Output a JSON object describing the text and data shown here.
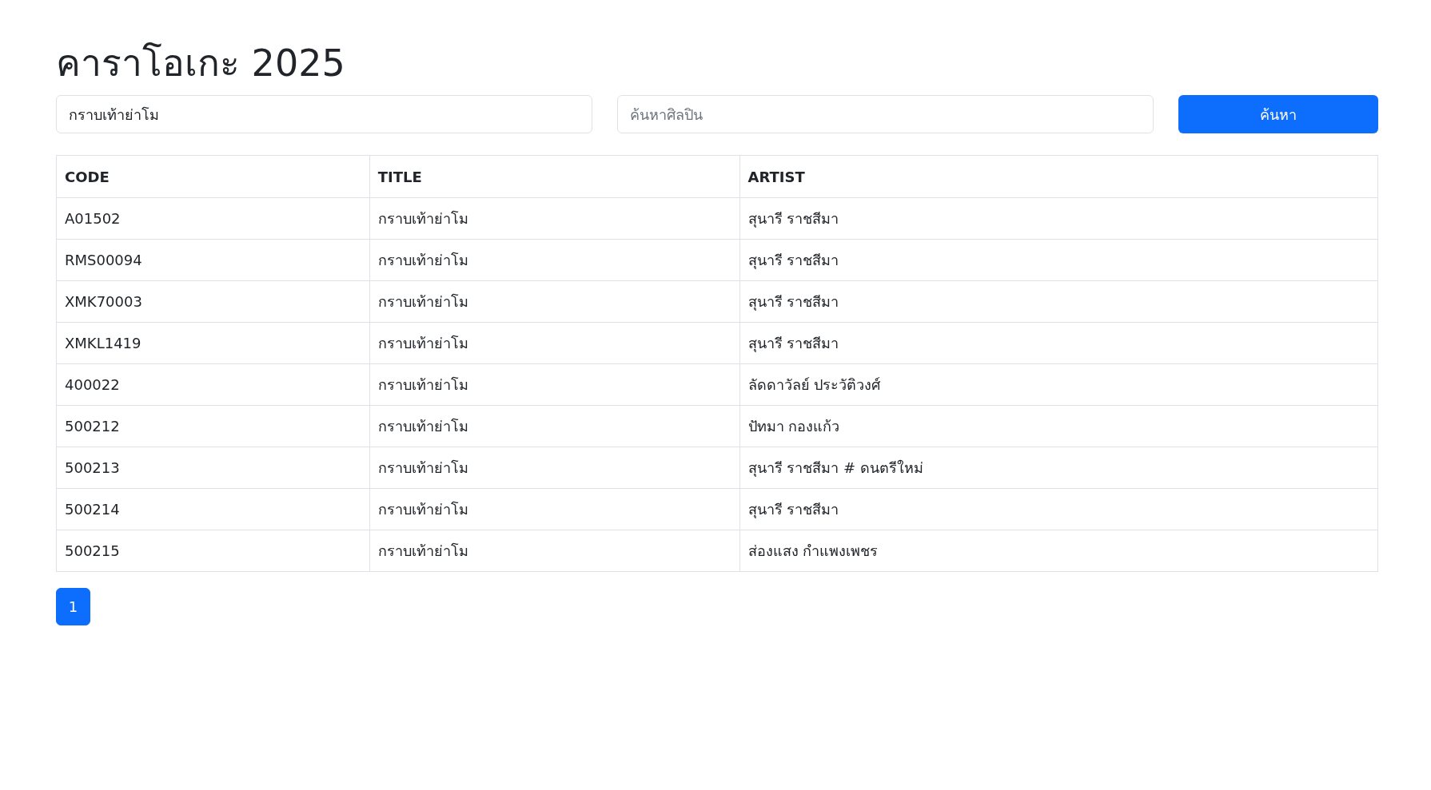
{
  "title": "คาราโอเกะ 2025",
  "search": {
    "title_value": "กราบเท้าย่าโม",
    "artist_placeholder": "ค้นหาศิลปิน",
    "button": "ค้นหา"
  },
  "table": {
    "columns": [
      "CODE",
      "TITLE",
      "ARTIST"
    ],
    "rows": [
      [
        "A01502",
        "กราบเท้าย่าโม",
        "สุนารี ราชสีมา"
      ],
      [
        "RMS00094",
        "กราบเท้าย่าโม",
        "สุนารี ราชสีมา"
      ],
      [
        "XMK70003",
        "กราบเท้าย่าโม",
        "สุนารี ราชสีมา"
      ],
      [
        "XMKL1419",
        "กราบเท้าย่าโม",
        "สุนารี ราชสีมา"
      ],
      [
        "400022",
        "กราบเท้าย่าโม",
        "ลัดดาวัลย์ ประวัติวงศ์"
      ],
      [
        "500212",
        "กราบเท้าย่าโม",
        "ปัทมา กองแก้ว"
      ],
      [
        "500213",
        "กราบเท้าย่าโม",
        "สุนารี ราชสีมา # ดนตรีใหม่"
      ],
      [
        "500214",
        "กราบเท้าย่าโม",
        "สุนารี ราชสีมา"
      ],
      [
        "500215",
        "กราบเท้าย่าโม",
        "ส่องแสง กำแพงเพชร"
      ]
    ]
  },
  "pagination": [
    {
      "label": "1",
      "selected": true
    }
  ]
}
